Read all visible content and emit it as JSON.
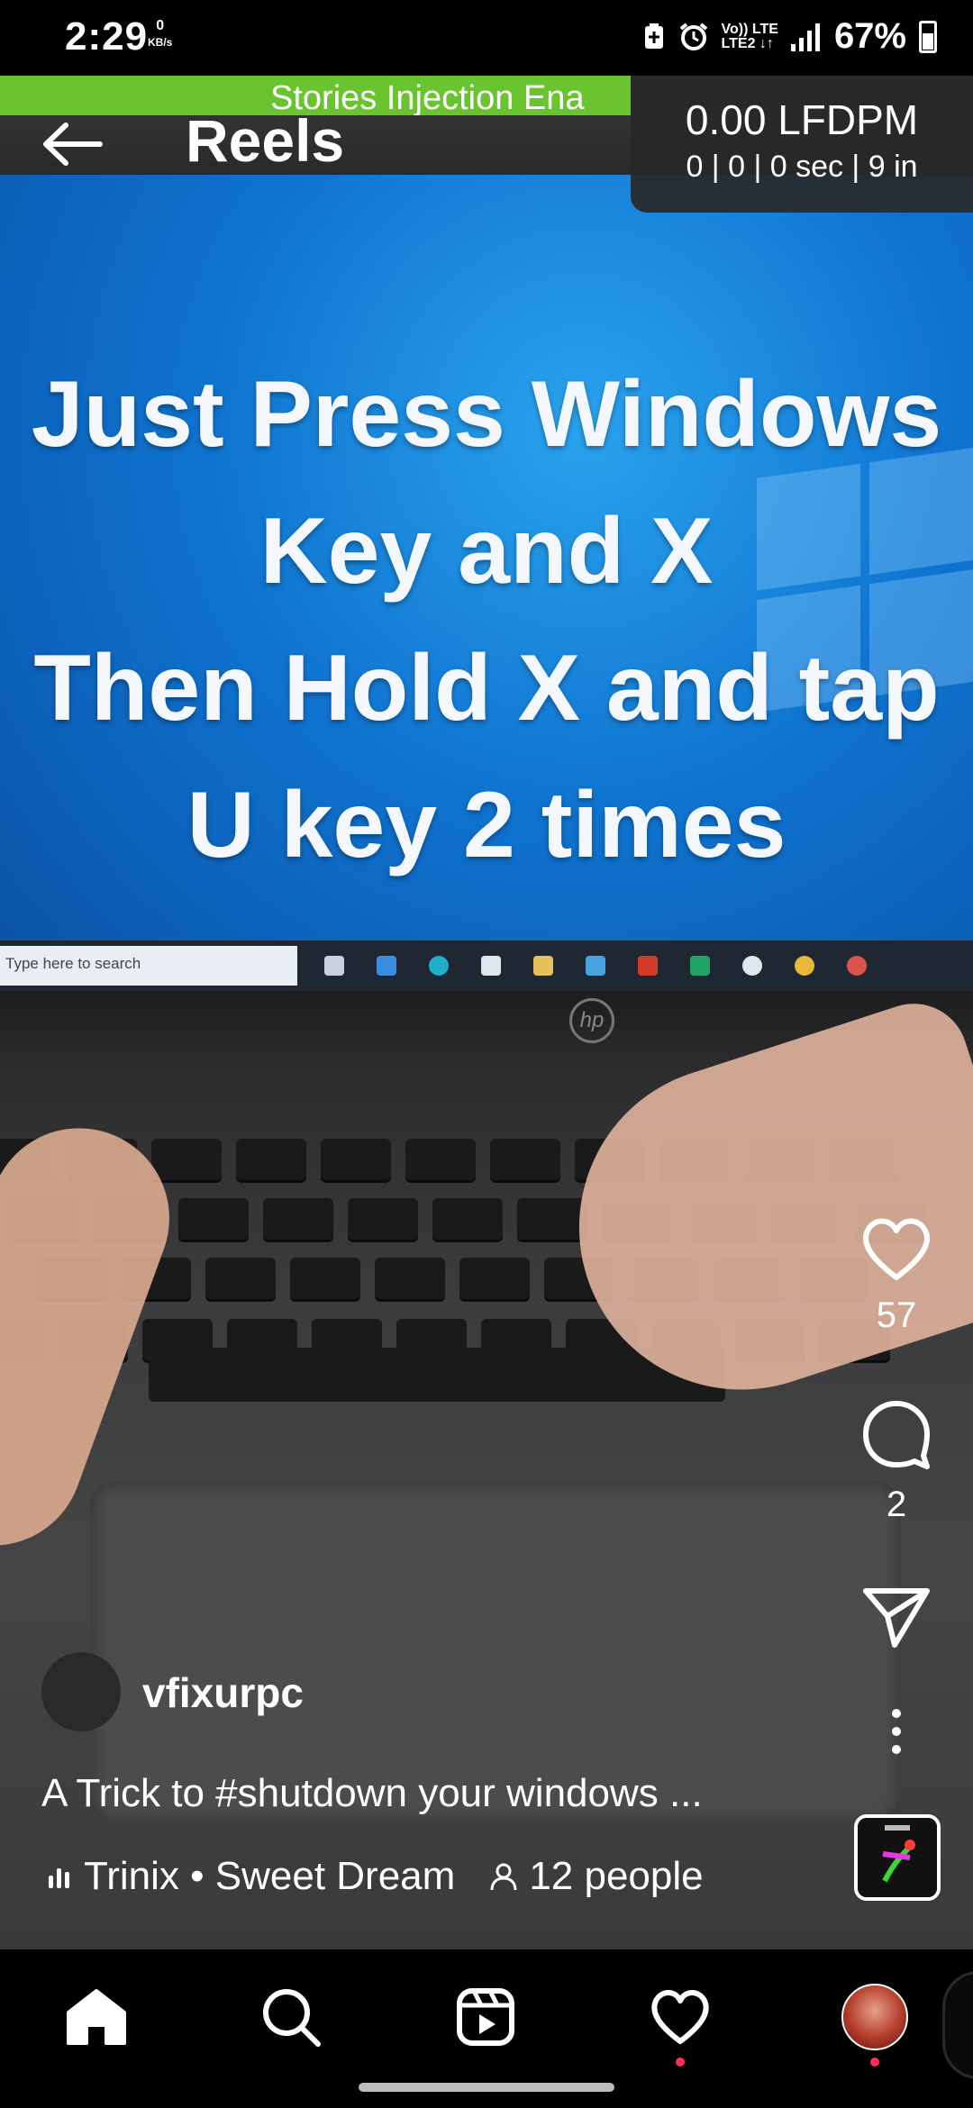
{
  "status_bar": {
    "time": "2:29",
    "net_speed_value": "0",
    "net_speed_unit": "KB/s",
    "network_line1": "Vo)) LTE",
    "network_line2": "LTE2 ↓↑",
    "battery": "67%"
  },
  "debug_overlay": {
    "banner_text": "Stories Injection Ena",
    "lfdpm_value": "0.00 LFDPM",
    "lfdpm_stats": "0 | 0 | 0 sec | 9 in"
  },
  "header": {
    "back_icon": "arrow-left-icon",
    "title": "Reels"
  },
  "video": {
    "overlay_lines": [
      "Just Press Windows",
      "Key and X",
      "Then Hold X and tap",
      "U key 2 times"
    ],
    "taskbar_search_placeholder": "Type here to search",
    "laptop_logo": "hp"
  },
  "actions": {
    "like_icon": "heart-icon",
    "like_count": "57",
    "comment_icon": "comment-icon",
    "comment_count": "2",
    "share_icon": "send-icon",
    "more_icon": "more-vertical-icon"
  },
  "post": {
    "username": "vfixurpc",
    "caption": "A Trick to #shutdown your windows ...",
    "audio": "Trinix • Sweet Dream",
    "people": "12 people"
  },
  "bottom_nav": {
    "items": [
      "home-icon",
      "search-icon",
      "reels-icon",
      "activity-heart-icon",
      "profile-avatar"
    ],
    "notification_color": "#ff2e55"
  },
  "colors": {
    "banner_green": "#6ac42f",
    "overlay_box": "#282828"
  }
}
